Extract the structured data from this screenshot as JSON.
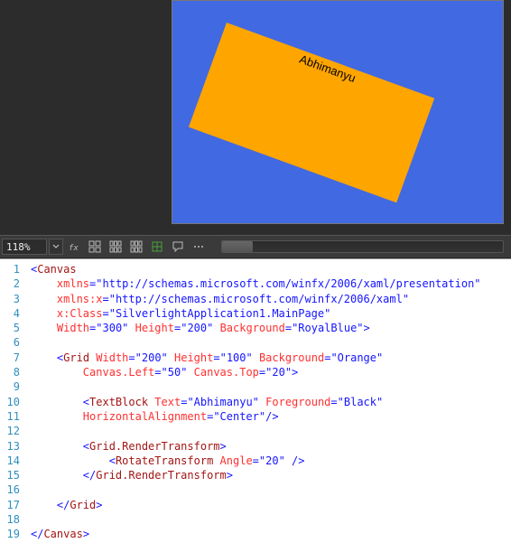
{
  "zoom_value": "118%",
  "preview_text": "Abhimanyu",
  "icons": [
    "fx",
    "grid4",
    "grid6",
    "grid6b",
    "split",
    "chat",
    "dots"
  ],
  "code": {
    "lines": [
      {
        "n": 1,
        "seg": [
          {
            "t": "<",
            "c": "sym"
          },
          {
            "t": "Canvas",
            "c": "el"
          }
        ]
      },
      {
        "n": 2,
        "seg": [
          {
            "t": "    "
          },
          {
            "t": "xmlns",
            "c": "attr"
          },
          {
            "t": "=",
            "c": "sym"
          },
          {
            "t": "\"http://schemas.microsoft.com/winfx/2006/xaml/presentation\"",
            "c": "val"
          }
        ]
      },
      {
        "n": 3,
        "seg": [
          {
            "t": "    "
          },
          {
            "t": "xmlns:x",
            "c": "attr"
          },
          {
            "t": "=",
            "c": "sym"
          },
          {
            "t": "\"http://schemas.microsoft.com/winfx/2006/xaml\"",
            "c": "val"
          }
        ]
      },
      {
        "n": 4,
        "seg": [
          {
            "t": "    "
          },
          {
            "t": "x:Class",
            "c": "attr"
          },
          {
            "t": "=",
            "c": "sym"
          },
          {
            "t": "\"SilverlightApplication1.MainPage\"",
            "c": "val"
          }
        ]
      },
      {
        "n": 5,
        "seg": [
          {
            "t": "    "
          },
          {
            "t": "Width",
            "c": "attr"
          },
          {
            "t": "=",
            "c": "sym"
          },
          {
            "t": "\"300\"",
            "c": "val"
          },
          {
            "t": " "
          },
          {
            "t": "Height",
            "c": "attr"
          },
          {
            "t": "=",
            "c": "sym"
          },
          {
            "t": "\"200\"",
            "c": "val"
          },
          {
            "t": " "
          },
          {
            "t": "Background",
            "c": "attr"
          },
          {
            "t": "=",
            "c": "sym"
          },
          {
            "t": "\"RoyalBlue\"",
            "c": "val"
          },
          {
            "t": ">",
            "c": "sym"
          }
        ]
      },
      {
        "n": 6,
        "seg": [
          {
            "t": " "
          }
        ]
      },
      {
        "n": 7,
        "seg": [
          {
            "t": "    "
          },
          {
            "t": "<",
            "c": "sym"
          },
          {
            "t": "Grid",
            "c": "el"
          },
          {
            "t": " "
          },
          {
            "t": "Width",
            "c": "attr"
          },
          {
            "t": "=",
            "c": "sym"
          },
          {
            "t": "\"200\"",
            "c": "val"
          },
          {
            "t": " "
          },
          {
            "t": "Height",
            "c": "attr"
          },
          {
            "t": "=",
            "c": "sym"
          },
          {
            "t": "\"100\"",
            "c": "val"
          },
          {
            "t": " "
          },
          {
            "t": "Background",
            "c": "attr"
          },
          {
            "t": "=",
            "c": "sym"
          },
          {
            "t": "\"Orange\"",
            "c": "val"
          }
        ]
      },
      {
        "n": 8,
        "seg": [
          {
            "t": "        "
          },
          {
            "t": "Canvas.Left",
            "c": "attr"
          },
          {
            "t": "=",
            "c": "sym"
          },
          {
            "t": "\"50\"",
            "c": "val"
          },
          {
            "t": " "
          },
          {
            "t": "Canvas.Top",
            "c": "attr"
          },
          {
            "t": "=",
            "c": "sym"
          },
          {
            "t": "\"20\"",
            "c": "val"
          },
          {
            "t": ">",
            "c": "sym"
          }
        ]
      },
      {
        "n": 9,
        "seg": [
          {
            "t": " "
          }
        ]
      },
      {
        "n": 10,
        "seg": [
          {
            "t": "        "
          },
          {
            "t": "<",
            "c": "sym"
          },
          {
            "t": "TextBlock",
            "c": "el"
          },
          {
            "t": " "
          },
          {
            "t": "Text",
            "c": "attr"
          },
          {
            "t": "=",
            "c": "sym"
          },
          {
            "t": "\"Abhimanyu\"",
            "c": "val"
          },
          {
            "t": " "
          },
          {
            "t": "Foreground",
            "c": "attr"
          },
          {
            "t": "=",
            "c": "sym"
          },
          {
            "t": "\"Black\"",
            "c": "val"
          }
        ]
      },
      {
        "n": 11,
        "seg": [
          {
            "t": "        "
          },
          {
            "t": "HorizontalAlignment",
            "c": "attr"
          },
          {
            "t": "=",
            "c": "sym"
          },
          {
            "t": "\"Center\"",
            "c": "val"
          },
          {
            "t": "/>",
            "c": "sym"
          }
        ]
      },
      {
        "n": 12,
        "seg": [
          {
            "t": " "
          }
        ]
      },
      {
        "n": 13,
        "seg": [
          {
            "t": "        "
          },
          {
            "t": "<",
            "c": "sym"
          },
          {
            "t": "Grid.RenderTransform",
            "c": "el"
          },
          {
            "t": ">",
            "c": "sym"
          }
        ]
      },
      {
        "n": 14,
        "seg": [
          {
            "t": "            "
          },
          {
            "t": "<",
            "c": "sym"
          },
          {
            "t": "RotateTransform",
            "c": "el"
          },
          {
            "t": " "
          },
          {
            "t": "Angle",
            "c": "attr"
          },
          {
            "t": "=",
            "c": "sym"
          },
          {
            "t": "\"20\"",
            "c": "val"
          },
          {
            "t": " />",
            "c": "sym"
          }
        ]
      },
      {
        "n": 15,
        "seg": [
          {
            "t": "        "
          },
          {
            "t": "</",
            "c": "sym"
          },
          {
            "t": "Grid.RenderTransform",
            "c": "el"
          },
          {
            "t": ">",
            "c": "sym"
          }
        ]
      },
      {
        "n": 16,
        "seg": [
          {
            "t": " "
          }
        ]
      },
      {
        "n": 17,
        "seg": [
          {
            "t": "    "
          },
          {
            "t": "</",
            "c": "sym"
          },
          {
            "t": "Grid",
            "c": "el"
          },
          {
            "t": ">",
            "c": "sym"
          }
        ]
      },
      {
        "n": 18,
        "seg": [
          {
            "t": " "
          }
        ]
      },
      {
        "n": 19,
        "seg": [
          {
            "t": "</",
            "c": "sym"
          },
          {
            "t": "Canvas",
            "c": "el"
          },
          {
            "t": ">",
            "c": "sym"
          }
        ]
      }
    ]
  }
}
